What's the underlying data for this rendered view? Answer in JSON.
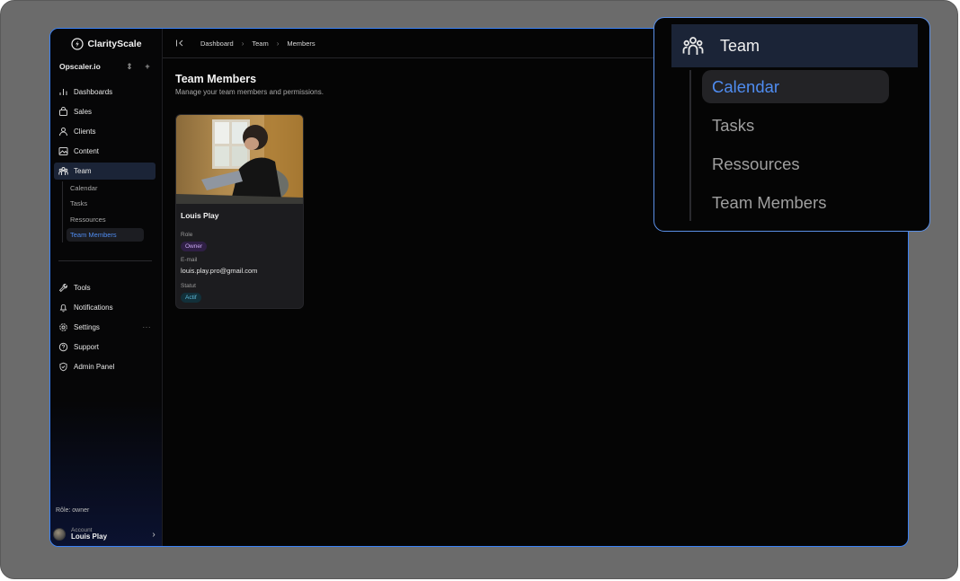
{
  "app": {
    "brand": "ClarityScale",
    "workspace": "Opscaler.io"
  },
  "sidebar": {
    "items": [
      {
        "label": "Dashboards",
        "icon": "bar-chart-icon"
      },
      {
        "label": "Sales",
        "icon": "shopping-bag-icon"
      },
      {
        "label": "Clients",
        "icon": "user-icon"
      },
      {
        "label": "Content",
        "icon": "image-icon"
      },
      {
        "label": "Team",
        "icon": "team-icon",
        "active": true
      }
    ],
    "team_sub": [
      "Calendar",
      "Tasks",
      "Ressources",
      "Team Members"
    ],
    "bottom_items": [
      {
        "label": "Tools",
        "icon": "wrench-icon"
      },
      {
        "label": "Notifications",
        "icon": "bell-icon"
      },
      {
        "label": "Settings",
        "icon": "gear-icon",
        "more": "···"
      },
      {
        "label": "Support",
        "icon": "help-icon"
      },
      {
        "label": "Admin Panel",
        "icon": "shield-icon"
      }
    ],
    "role": "Rôle: owner",
    "account": {
      "label": "Account",
      "name": "Louis Play"
    }
  },
  "topbar": {
    "breadcrumb": [
      "Dashboard",
      "Team",
      "Members"
    ]
  },
  "main": {
    "title": "Team Members",
    "subtitle": "Manage your team members and permissions.",
    "member": {
      "name": "Louis Play",
      "role_label": "Role",
      "role": "Owner",
      "email_label": "E-mail",
      "email": "louis.play.pro@gmail.com",
      "status_label": "Statut",
      "status": "Actif"
    }
  },
  "zoom": {
    "header": "Team",
    "items": [
      "Calendar",
      "Tasks",
      "Ressources",
      "Team Members"
    ]
  },
  "colors": {
    "accent": "#4f8cf0",
    "active_bg": "#1b2437",
    "frame_border": "#3b82f6"
  }
}
